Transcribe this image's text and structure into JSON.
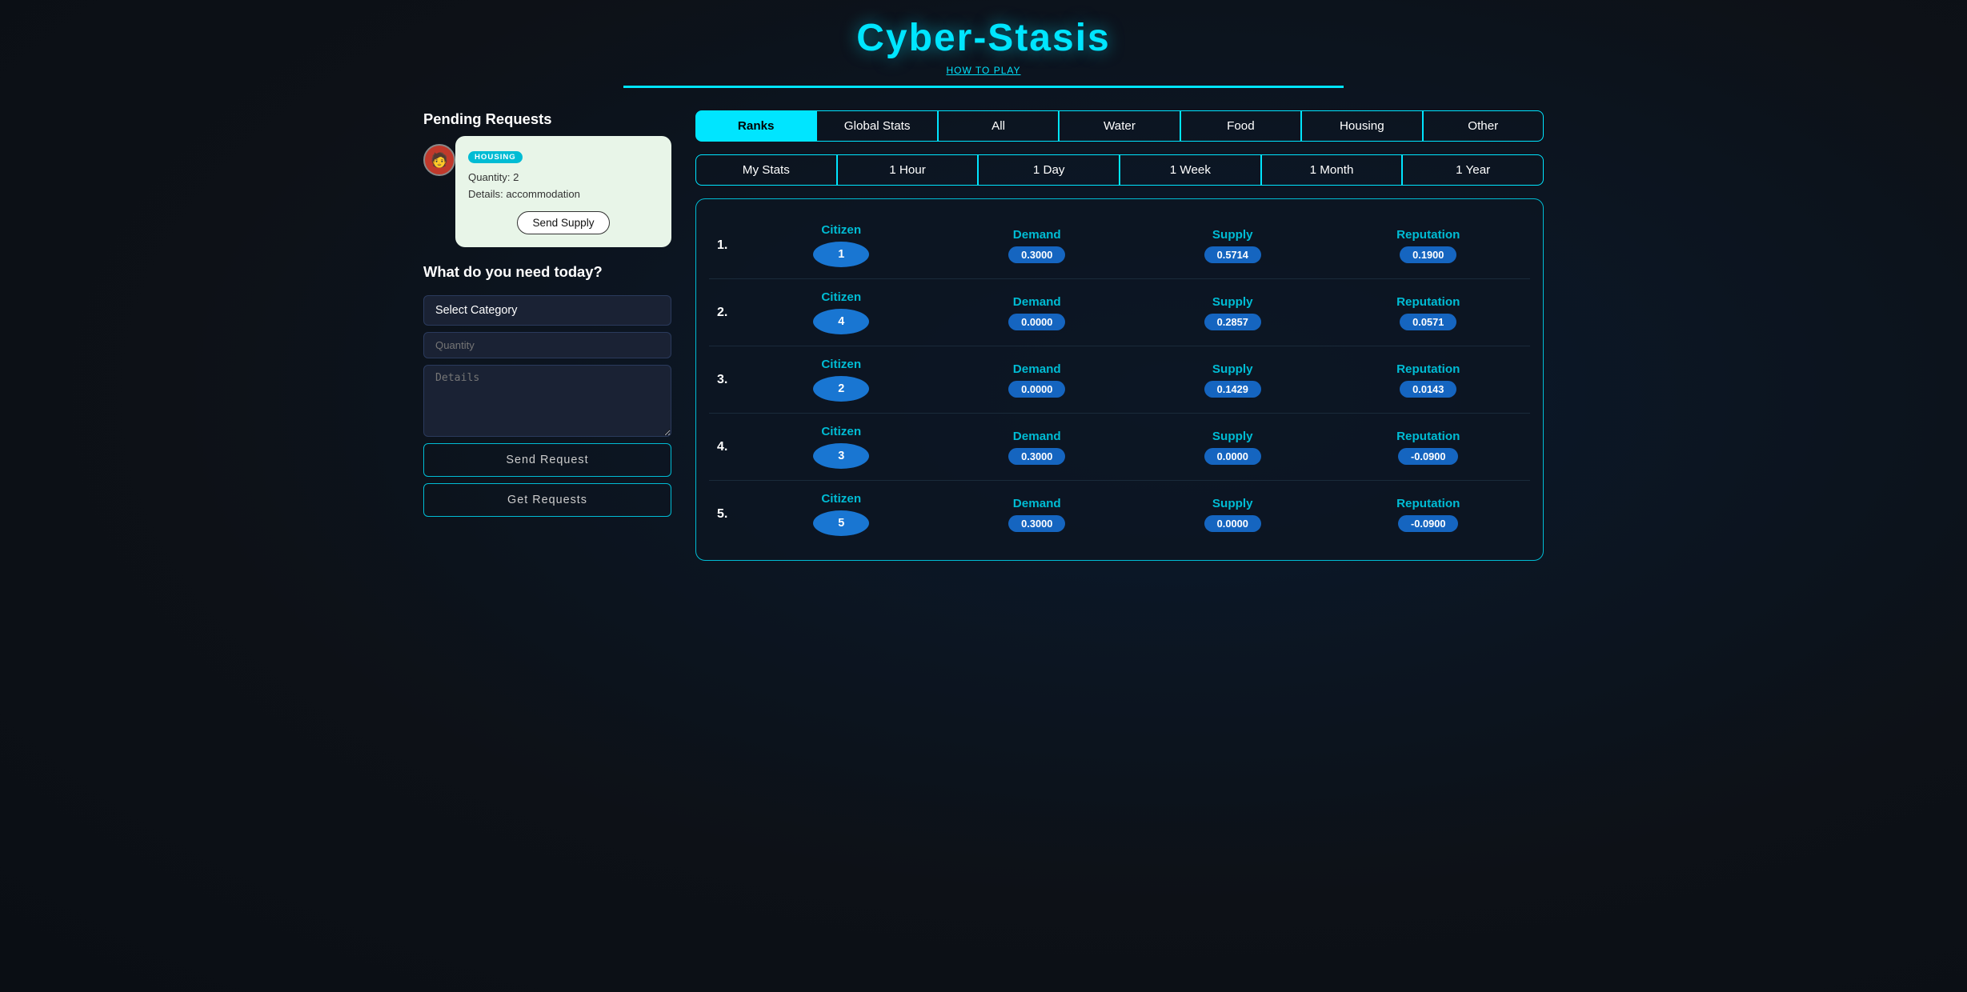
{
  "app": {
    "title": "Cyber-Stasis",
    "how_to_play": "HOW TO PLAY"
  },
  "tabs": {
    "row1": [
      {
        "id": "ranks",
        "label": "Ranks",
        "active": true
      },
      {
        "id": "global-stats",
        "label": "Global Stats",
        "active": false
      },
      {
        "id": "all",
        "label": "All",
        "active": false
      },
      {
        "id": "water",
        "label": "Water",
        "active": false
      },
      {
        "id": "food",
        "label": "Food",
        "active": false
      },
      {
        "id": "housing",
        "label": "Housing",
        "active": false
      },
      {
        "id": "other",
        "label": "Other",
        "active": false
      }
    ],
    "row2": [
      {
        "id": "my-stats",
        "label": "My Stats",
        "active": false
      },
      {
        "id": "1-hour",
        "label": "1 Hour",
        "active": false
      },
      {
        "id": "1-day",
        "label": "1 Day",
        "active": false
      },
      {
        "id": "1-week",
        "label": "1 Week",
        "active": false
      },
      {
        "id": "1-month",
        "label": "1 Month",
        "active": false
      },
      {
        "id": "1-year",
        "label": "1 Year",
        "active": false
      }
    ]
  },
  "pending_requests": {
    "section_title": "Pending Requests",
    "card": {
      "category": "HOUSING",
      "quantity_label": "Quantity: 2",
      "details_label": "Details: accommodation",
      "send_button": "Send Supply"
    }
  },
  "need_section": {
    "title": "What do you need today?",
    "select_placeholder": "Select Category",
    "quantity_placeholder": "Quantity",
    "details_placeholder": "Details",
    "send_request_btn": "Send Request",
    "get_requests_btn": "Get Requests"
  },
  "ranks": [
    {
      "rank": "1.",
      "citizen_id": "1",
      "demand": "0.3000",
      "supply": "0.5714",
      "reputation": "0.1900"
    },
    {
      "rank": "2.",
      "citizen_id": "4",
      "demand": "0.0000",
      "supply": "0.2857",
      "reputation": "0.0571"
    },
    {
      "rank": "3.",
      "citizen_id": "2",
      "demand": "0.0000",
      "supply": "0.1429",
      "reputation": "0.0143"
    },
    {
      "rank": "4.",
      "citizen_id": "3",
      "demand": "0.3000",
      "supply": "0.0000",
      "reputation": "-0.0900"
    },
    {
      "rank": "5.",
      "citizen_id": "5",
      "demand": "0.3000",
      "supply": "0.0000",
      "reputation": "-0.0900"
    }
  ],
  "columns": {
    "citizen": "Citizen",
    "demand": "Demand",
    "supply": "Supply",
    "reputation": "Reputation"
  }
}
